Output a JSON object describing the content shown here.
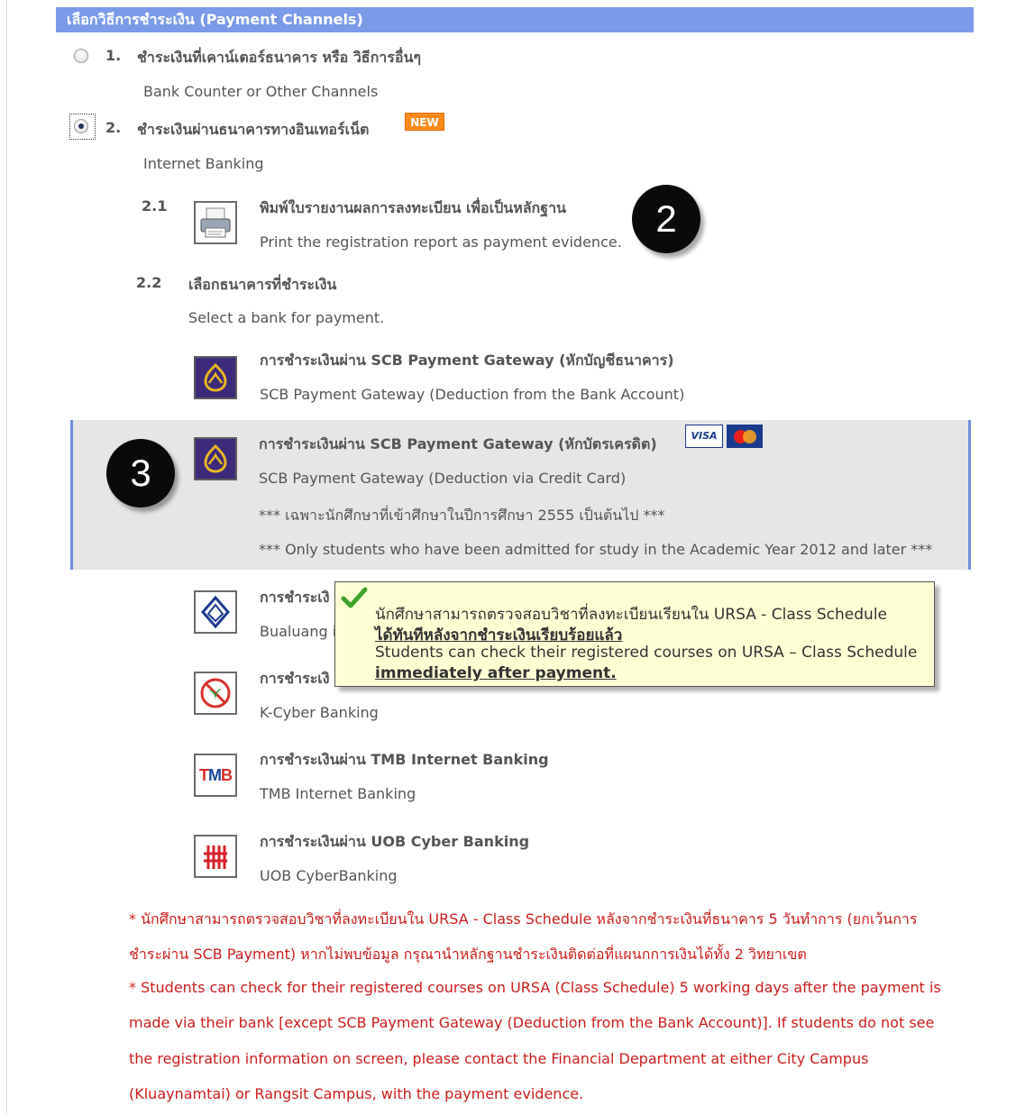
{
  "header": {
    "title": "เลือกวิธีการชำระเงิน (Payment Channels)"
  },
  "option1": {
    "number": "1.",
    "thai": "ชำระเงินที่เคาน์เตอร์ธนาคาร หรือ วิธีการอื่นๆ",
    "english": "Bank Counter or Other Channels",
    "selected": false
  },
  "option2": {
    "number": "2.",
    "thai": "ชำระเงินผ่านธนาคารทางอินเทอร์เน็ต",
    "english": "Internet Banking",
    "badge": "NEW",
    "selected": true
  },
  "step21": {
    "number": "2.1",
    "thai": "พิมพ์ใบรายงานผลการลงทะเบียน เพื่อเป็นหลักฐาน",
    "english": "Print the registration report as payment evidence."
  },
  "step22": {
    "number": "2.2",
    "thai": "เลือกธนาคารที่ชำระเงิน",
    "english": "Select a bank for payment."
  },
  "banks": [
    {
      "thai": "การชำระเงินผ่าน SCB Payment Gateway (หักบัญชีธนาคาร)",
      "english": "SCB Payment Gateway (Deduction from the Bank Account)",
      "icon": "scb-logo-icon"
    },
    {
      "thai": "การชำระเงินผ่าน SCB Payment Gateway (หักบัตรเครดิต)",
      "english": "SCB Payment Gateway (Deduction via Credit Card)",
      "icon": "scb-logo-icon",
      "note_th": "*** เฉพาะนักศึกษาที่เข้าศึกษาในปีการศึกษา 2555 เป็นต้นไป ***",
      "note_en": "*** Only students who have been admitted for study in the Academic Year 2012 and later ***",
      "card_visa": "VISA"
    },
    {
      "thai": "การชำระเงิ",
      "english": "Bualuang i",
      "icon": "bangkok-bank-icon"
    },
    {
      "thai": "การชำระเงิ",
      "english": "K-Cyber Banking",
      "icon": "kbank-icon"
    },
    {
      "thai": "การชำระเงินผ่าน TMB Internet Banking",
      "english": "TMB Internet Banking",
      "icon": "tmb-icon",
      "logo_text": "TMB"
    },
    {
      "thai": "การชำระเงินผ่าน UOB Cyber Banking",
      "english": "UOB CyberBanking",
      "icon": "uob-icon"
    }
  ],
  "callouts": {
    "two": "2",
    "three": "3"
  },
  "tooltip": {
    "line1": "นักศึกษาสามารถตรวจสอบวิชาที่ลงทะเบียนเรียนใน URSA - Class Schedule",
    "line2": "ได้ทันทีหลังจากชำระเงินเรียบร้อยแล้ว",
    "line3": "Students can check their registered courses on URSA – Class Schedule",
    "line4": "immediately after payment."
  },
  "footnotes": {
    "th1": "* นักศึกษาสามารถตรวจสอบวิชาที่ลงทะเบียนใน URSA - Class Schedule หลังจากชำระเงินที่ธนาคาร 5 วันทำการ (ยกเว้นการ",
    "th2": "ชำระผ่าน SCB Payment) หากไม่พบข้อมูล กรุณานำหลักฐานชำระเงินติดต่อที่แผนกการเงินได้ทั้ง 2 วิทยาเขต",
    "en1": "* Students can check for their registered courses on URSA (Class Schedule) 5 working days after the payment is",
    "en2": "made via their bank [except SCB Payment Gateway (Deduction from the Bank Account)]. If students do not see",
    "en3": "the registration information on screen, please contact the Financial Department at either City Campus",
    "en4": "(Kluaynamtai) or Rangsit Campus, with the payment evidence."
  },
  "colors": {
    "header": "#7b9ae8",
    "highlight_border": "#6f8ee0",
    "note_red": "#cc1d1d",
    "tooltip_bg": "#ffffd6"
  }
}
